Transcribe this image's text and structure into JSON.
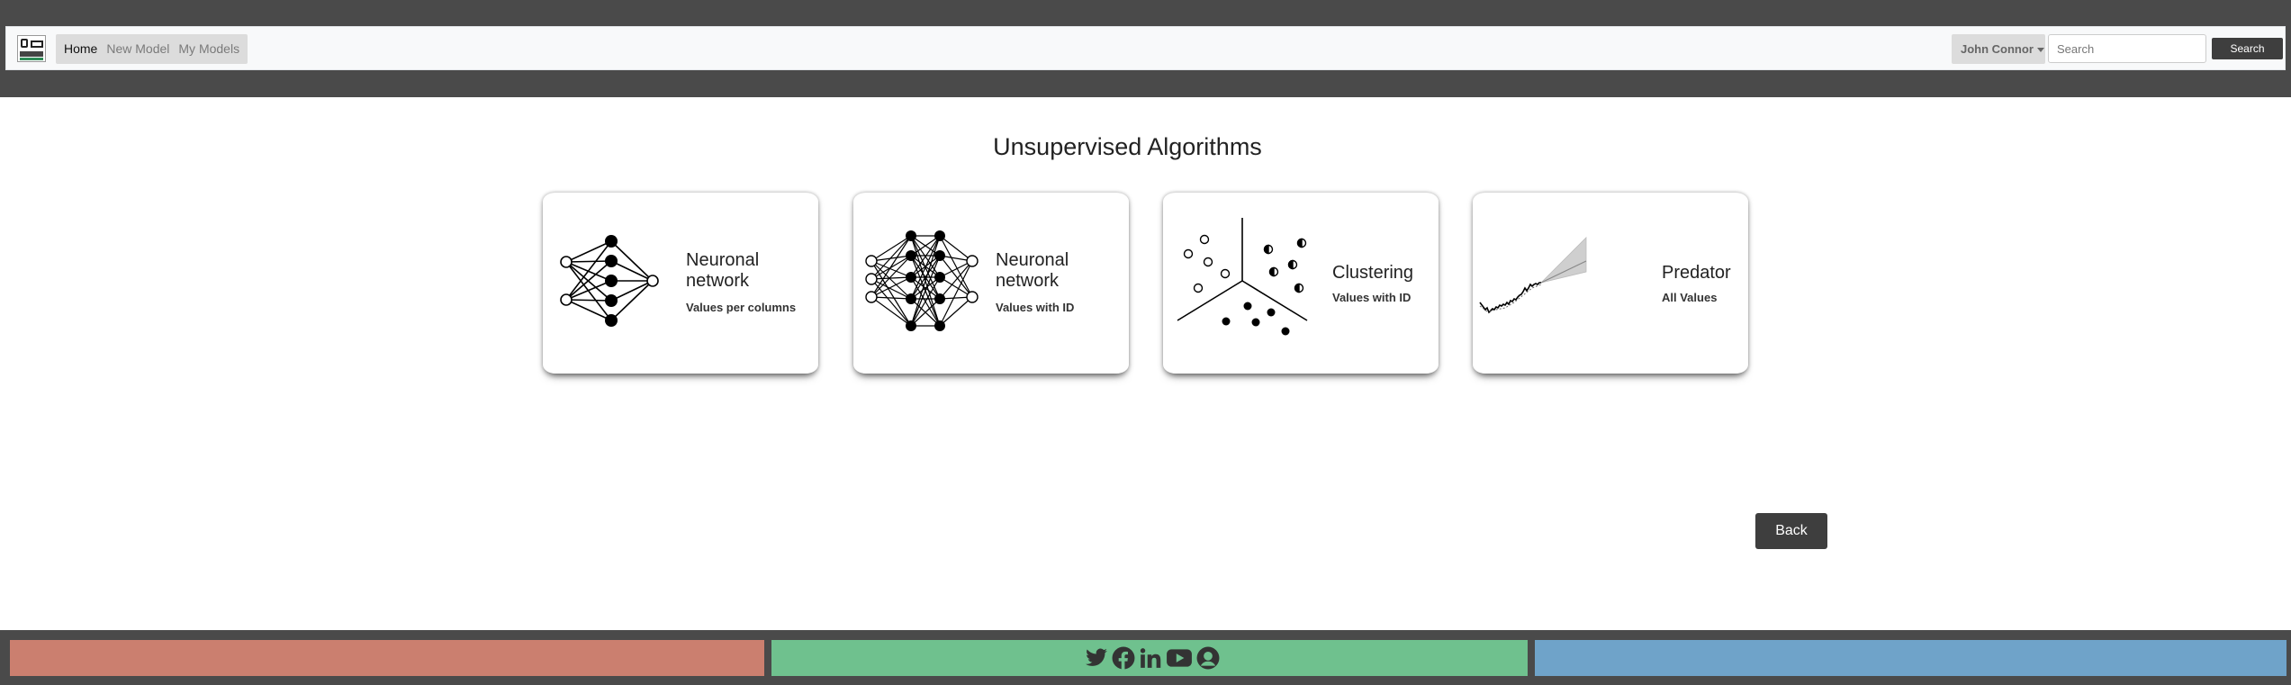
{
  "nav": {
    "logo_icon": "app-logo-icon",
    "links": [
      {
        "label": "Home",
        "active": true
      },
      {
        "label": "New Model",
        "active": false
      },
      {
        "label": "My Models",
        "active": false
      }
    ],
    "user": "John Connor",
    "search_placeholder": "Search",
    "search_value": "",
    "search_button": "Search"
  },
  "page": {
    "title": "Unsupervised Algorithms",
    "back_label": "Back"
  },
  "cards": [
    {
      "title_line1": "Neuronal",
      "title_line2": "network",
      "subtitle": "Values per columns",
      "icon": "neural-network-icon"
    },
    {
      "title_line1": "Neuronal",
      "title_line2": "network",
      "subtitle": "Values with ID",
      "icon": "deep-neural-network-icon"
    },
    {
      "title_line1": "Clustering",
      "title_line2": "",
      "subtitle": "Values with ID",
      "icon": "clustering-icon"
    },
    {
      "title_line1": "Predator",
      "title_line2": "",
      "subtitle": "All Values",
      "icon": "forecast-chart-icon"
    }
  ],
  "footer": {
    "panel_colors": [
      "#cb7f6f",
      "#6fc18e",
      "#6fa3c9"
    ],
    "social_icons": [
      "twitter-icon",
      "facebook-icon",
      "linkedin-icon",
      "youtube-icon",
      "github-icon"
    ]
  }
}
